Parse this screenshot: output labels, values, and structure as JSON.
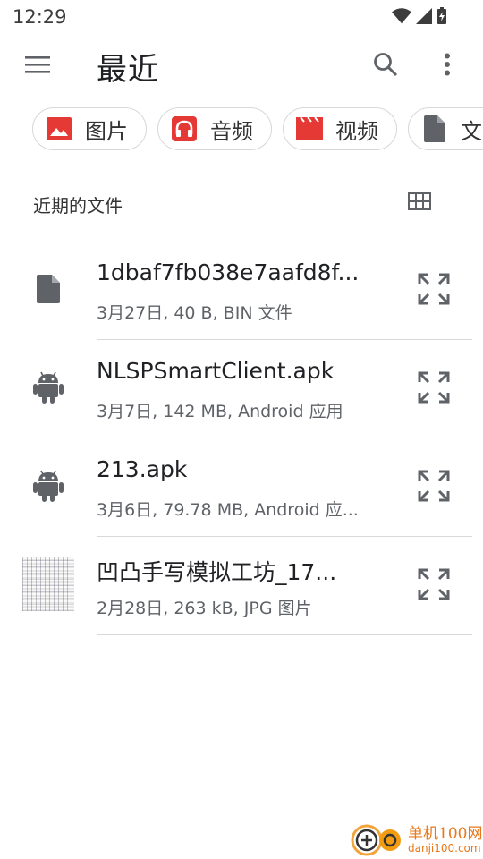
{
  "status_bar": {
    "time": "12:29"
  },
  "app_bar": {
    "title": "最近"
  },
  "chips": [
    {
      "label": "图片",
      "icon": "image-icon",
      "color": "#e53935"
    },
    {
      "label": "音频",
      "icon": "headphones-icon",
      "color": "#e53935"
    },
    {
      "label": "视频",
      "icon": "movie-icon",
      "color": "#e53935"
    },
    {
      "label": "文",
      "icon": "document-icon",
      "color": "#5f6368"
    }
  ],
  "section": {
    "title": "近期的文件"
  },
  "files": [
    {
      "name": "1dbaf7fb038e7aafd8f...",
      "meta": "3月27日, 40 B, BIN 文件",
      "icon": "file-icon"
    },
    {
      "name": "NLSPSmartClient.apk",
      "meta": "3月7日, 142 MB, Android 应用",
      "icon": "android-icon"
    },
    {
      "name": "213.apk",
      "meta": "3月6日, 79.78 MB, Android 应...",
      "icon": "android-icon"
    },
    {
      "name": "凹凸手写模拟工坊_17...",
      "meta": "2月28日, 263 kB, JPG 图片",
      "icon": "image-thumbnail"
    }
  ],
  "watermark": {
    "name": "单机100网",
    "url": "danji100.com"
  },
  "colors": {
    "accent_red": "#e53935",
    "icon_grey": "#5f6368",
    "watermark_orange": "#e8781b"
  }
}
